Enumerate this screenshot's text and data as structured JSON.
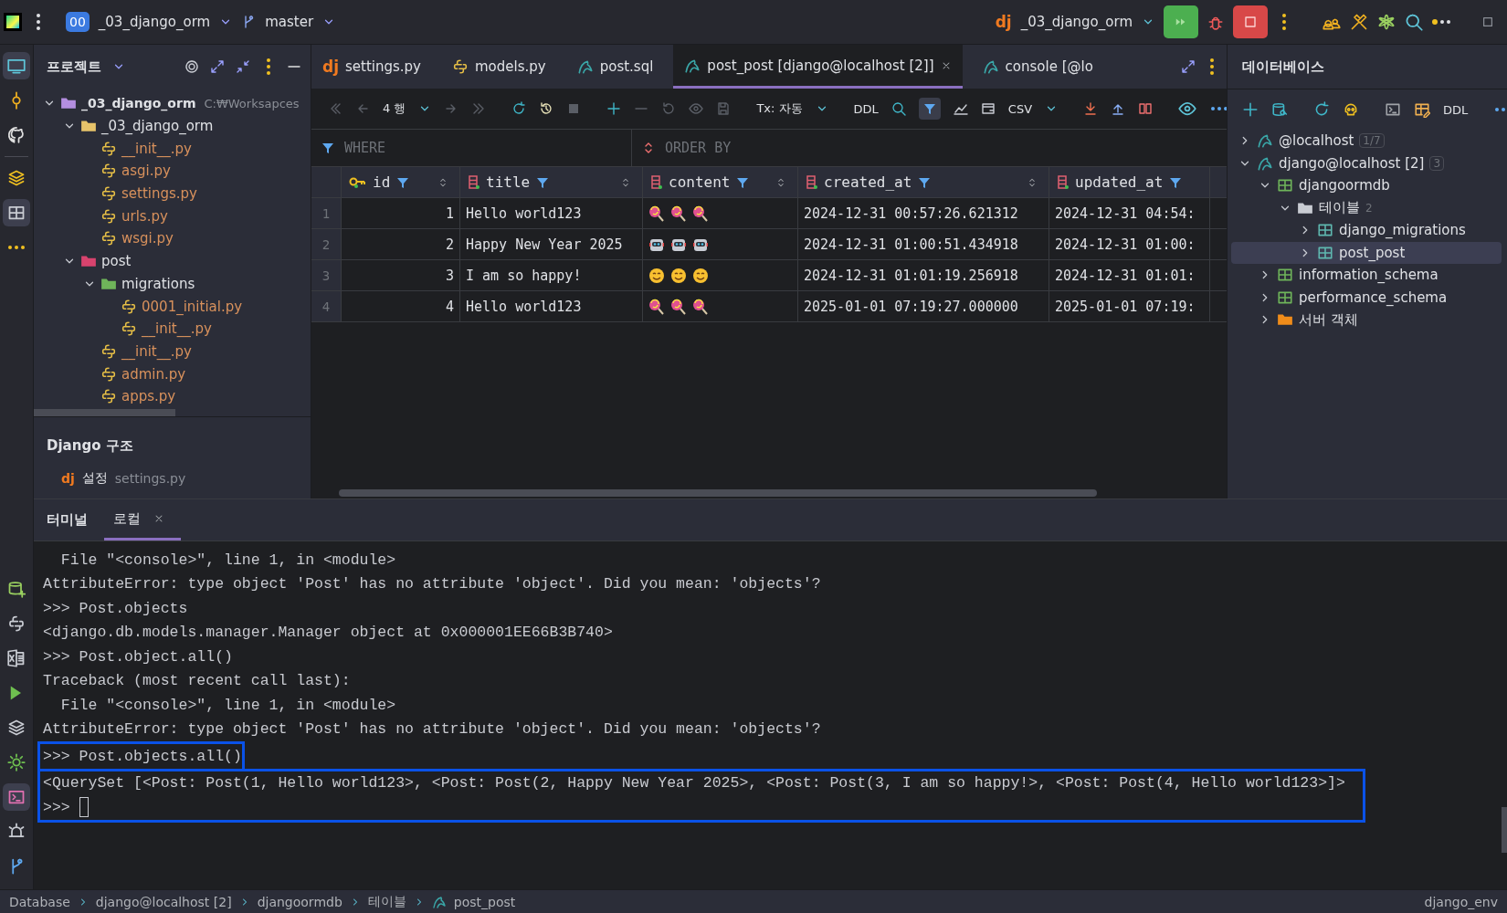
{
  "toolbar": {
    "project_badge": "00",
    "project": "_03_django_orm",
    "branch": "master",
    "run_config": "_03_django_orm",
    "run_config_icon": "dj"
  },
  "project_panel": {
    "title": "프로젝트",
    "tree": [
      {
        "label": "_03_django_orm",
        "path": "C:₩Worksapces",
        "kind": "project",
        "expanded": true,
        "children": [
          {
            "label": "_03_django_orm",
            "kind": "folder",
            "expanded": true,
            "children": [
              {
                "label": "__init__.py",
                "kind": "python"
              },
              {
                "label": "asgi.py",
                "kind": "python"
              },
              {
                "label": "settings.py",
                "kind": "python"
              },
              {
                "label": "urls.py",
                "kind": "python"
              },
              {
                "label": "wsgi.py",
                "kind": "python"
              }
            ]
          },
          {
            "label": "post",
            "kind": "package",
            "expanded": true,
            "children": [
              {
                "label": "migrations",
                "kind": "migrations",
                "expanded": true,
                "children": [
                  {
                    "label": "0001_initial.py",
                    "kind": "python"
                  },
                  {
                    "label": "__init__.py",
                    "kind": "python"
                  }
                ]
              },
              {
                "label": "__init__.py",
                "kind": "python"
              },
              {
                "label": "admin.py",
                "kind": "python"
              },
              {
                "label": "apps.py",
                "kind": "python"
              }
            ]
          }
        ]
      }
    ]
  },
  "django_structure": {
    "title": "Django 구조",
    "items": [
      {
        "icon": "dj",
        "label": "설정",
        "file": "settings.py"
      }
    ]
  },
  "editor_tabs": [
    {
      "label": "settings.py",
      "kind": "django",
      "icon": "dj",
      "selected": false
    },
    {
      "label": "models.py",
      "kind": "python",
      "selected": false
    },
    {
      "label": "post.sql",
      "kind": "sql",
      "selected": false
    },
    {
      "label": "post_post [django@localhost [2]]",
      "kind": "table",
      "selected": true
    },
    {
      "label": "console [@lo",
      "kind": "console",
      "selected": false
    }
  ],
  "data_toolbar": {
    "rows": "4 행",
    "tx": "Tx: 자동",
    "ddl": "DDL",
    "format": "CSV"
  },
  "filters": {
    "where": "WHERE",
    "order_by": "ORDER BY"
  },
  "table": {
    "columns": [
      {
        "name": "id",
        "kind": "key"
      },
      {
        "name": "title",
        "kind": "column"
      },
      {
        "name": "content",
        "kind": "column"
      },
      {
        "name": "created_at",
        "kind": "column"
      },
      {
        "name": "updated_at",
        "kind": "column"
      }
    ],
    "rows": [
      {
        "num": "1",
        "id": "1",
        "title": "Hello world123",
        "content": {
          "kind": "lollipop"
        },
        "created_at": "2024-12-31 00:57:26.621312",
        "updated_at": "2024-12-31 04:54:"
      },
      {
        "num": "2",
        "id": "2",
        "title": "Happy New Year 2025",
        "content": {
          "kind": "robot"
        },
        "created_at": "2024-12-31 01:00:51.434918",
        "updated_at": "2024-12-31 01:00:"
      },
      {
        "num": "3",
        "id": "3",
        "title": "I am so happy!",
        "content": {
          "kind": "smile"
        },
        "created_at": "2024-12-31 01:01:19.256918",
        "updated_at": "2024-12-31 01:01:"
      },
      {
        "num": "4",
        "id": "4",
        "title": "Hello world123",
        "content": {
          "kind": "lollipop"
        },
        "created_at": "2025-01-01 07:19:27.000000",
        "updated_at": "2025-01-01 07:19:"
      }
    ]
  },
  "database_panel": {
    "title": "데이터베이스",
    "ddl": "DDL",
    "tree": [
      {
        "label": "@localhost",
        "badge": "1/7",
        "kind": "connection",
        "expanded": false,
        "selected": false
      },
      {
        "label": "django@localhost [2]",
        "badge": "3",
        "kind": "connection",
        "expanded": true,
        "selected": false,
        "children": [
          {
            "label": "djangoormdb",
            "kind": "schema",
            "expanded": true,
            "selected": false,
            "children": [
              {
                "label": "테이블",
                "count": "2",
                "kind": "folder",
                "expanded": true,
                "selected": false,
                "children": [
                  {
                    "label": "django_migrations",
                    "kind": "table",
                    "expanded": false,
                    "selected": false
                  },
                  {
                    "label": "post_post",
                    "kind": "table",
                    "expanded": false,
                    "selected": true
                  }
                ]
              }
            ]
          },
          {
            "label": "information_schema",
            "kind": "schema",
            "expanded": false,
            "selected": false
          },
          {
            "label": "performance_schema",
            "kind": "schema",
            "expanded": false,
            "selected": false
          },
          {
            "label": "서버 객체",
            "kind": "server",
            "expanded": false,
            "selected": false
          }
        ]
      }
    ]
  },
  "terminal": {
    "tabs": [
      {
        "label": "터미널",
        "selected": false,
        "closable": false
      },
      {
        "label": "로컬",
        "selected": true,
        "closable": true
      }
    ],
    "blocks": [
      {
        "highlighted": false,
        "lines": [
          {
            "text": "  File \"<console>\", line 1, in <module>"
          },
          {
            "text": "AttributeError: type object 'Post' has no attribute 'object'. Did you mean: 'objects'?"
          },
          {
            "text": ">>> Post.objects"
          },
          {
            "text": "<django.db.models.manager.Manager object at 0x000001EE66B3B740>"
          },
          {
            "text": ">>> Post.object.all()"
          },
          {
            "text": "Traceback (most recent call last):"
          },
          {
            "text": "  File \"<console>\", line 1, in <module>"
          },
          {
            "text": "AttributeError: type object 'Post' has no attribute 'object'. Did you mean: 'objects'?"
          }
        ]
      },
      {
        "highlighted": true,
        "lines": [
          {
            "text": ">>> Post.objects.all()"
          }
        ]
      },
      {
        "highlighted": true,
        "lines": [
          {
            "text": "<QuerySet [<Post: Post(1, Hello world123>, <Post: Post(2, Happy New Year 2025>, <Post: Post(3, I am so happy!>, <Post: Post(4, Hello world123>]>"
          },
          {
            "text": ">>> ",
            "cursor": true
          }
        ]
      }
    ]
  },
  "status_bar": {
    "breadcrumbs": [
      {
        "label": "Database",
        "kind": "text"
      },
      {
        "label": "django@localhost [2]",
        "kind": "text"
      },
      {
        "label": "djangoormdb",
        "kind": "text"
      },
      {
        "label": "테이블",
        "kind": "text"
      },
      {
        "label": "post_post",
        "kind": "table"
      }
    ],
    "env": "django_env"
  }
}
